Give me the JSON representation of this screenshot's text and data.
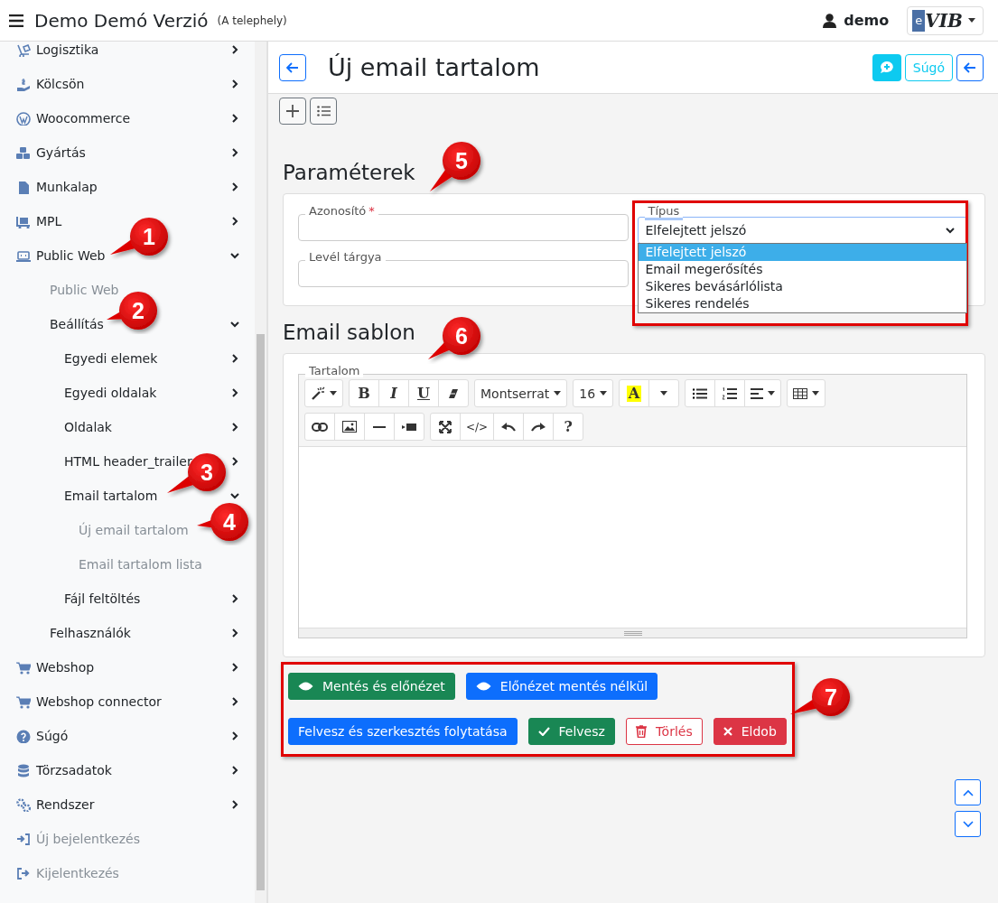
{
  "header": {
    "title": "Demo Demó Verzió",
    "subtitle": "(A telephely)",
    "user": "demo",
    "logo": {
      "mark": "e",
      "text": "VIB"
    }
  },
  "sidebar": {
    "items": [
      {
        "label": "Logisztika",
        "expanded": false
      },
      {
        "label": "Kölcsön",
        "expanded": false
      },
      {
        "label": "Woocommerce",
        "expanded": false
      },
      {
        "label": "Gyártás",
        "expanded": false
      },
      {
        "label": "Munkalap",
        "expanded": false
      },
      {
        "label": "MPL",
        "expanded": false
      },
      {
        "label": "Public Web",
        "expanded": true,
        "children": [
          {
            "label": "Public Web"
          },
          {
            "label": "Beállítás",
            "expanded": true,
            "children": [
              {
                "label": "Egyedi elemek",
                "expanded": false
              },
              {
                "label": "Egyedi oldalak",
                "expanded": false
              },
              {
                "label": "Oldalak",
                "expanded": false
              },
              {
                "label": "HTML header_trailer",
                "expanded": false
              },
              {
                "label": "Email tartalom",
                "expanded": true,
                "children": [
                  {
                    "label": "Új email tartalom"
                  },
                  {
                    "label": "Email tartalom lista"
                  }
                ]
              },
              {
                "label": "Fájl feltöltés",
                "expanded": false
              }
            ]
          },
          {
            "label": "Felhasználók",
            "expanded": false
          }
        ]
      },
      {
        "label": "Webshop",
        "expanded": false
      },
      {
        "label": "Webshop connector",
        "expanded": false
      },
      {
        "label": "Súgó",
        "expanded": false
      },
      {
        "label": "Törzsadatok",
        "expanded": false
      },
      {
        "label": "Rendszer",
        "expanded": false
      },
      {
        "label": "Új bejelentkezés"
      },
      {
        "label": "Kijelentkezés"
      }
    ]
  },
  "page": {
    "title": "Új email tartalom",
    "help_button": "Súgó"
  },
  "parameters": {
    "heading": "Paraméterek",
    "fields": [
      {
        "label": "Azonosító",
        "required_mark": "*"
      },
      {
        "label": "Levél tárgya"
      }
    ],
    "type_select": {
      "label": "Típus",
      "value": "Elfelejtett jelszó",
      "expanded": true,
      "options": [
        {
          "label": "Elfelejtett jelszó",
          "selected": true
        },
        {
          "label": "Email megerősítés",
          "selected": false
        },
        {
          "label": "Sikeres bevásárlólista",
          "selected": false
        },
        {
          "label": "Sikeres rendelés",
          "selected": false
        }
      ]
    }
  },
  "template": {
    "heading": "Email sablon",
    "editor": {
      "label": "Tartalom",
      "toolbar": {
        "bold": "B",
        "italic": "I",
        "underline": "U",
        "font": "Montserrat",
        "size": "16",
        "font_color": "A",
        "code": "</>",
        "help": "?"
      }
    }
  },
  "actions": [
    [
      {
        "label": "Mentés és előnézet",
        "kind": "success"
      },
      {
        "label": "Előnézet mentés nélkül",
        "kind": "primary"
      }
    ],
    [
      {
        "label": "Felvesz és szerkesztés folytatása",
        "kind": "primary"
      },
      {
        "label": "Felvesz",
        "kind": "success"
      },
      {
        "label": "Törlés",
        "kind": "outline-danger"
      },
      {
        "label": "Eldob",
        "kind": "danger"
      }
    ]
  ],
  "callouts": [
    {
      "number": "1"
    },
    {
      "number": "2"
    },
    {
      "number": "3"
    },
    {
      "number": "4"
    },
    {
      "number": "5"
    },
    {
      "number": "6"
    },
    {
      "number": "7"
    }
  ]
}
